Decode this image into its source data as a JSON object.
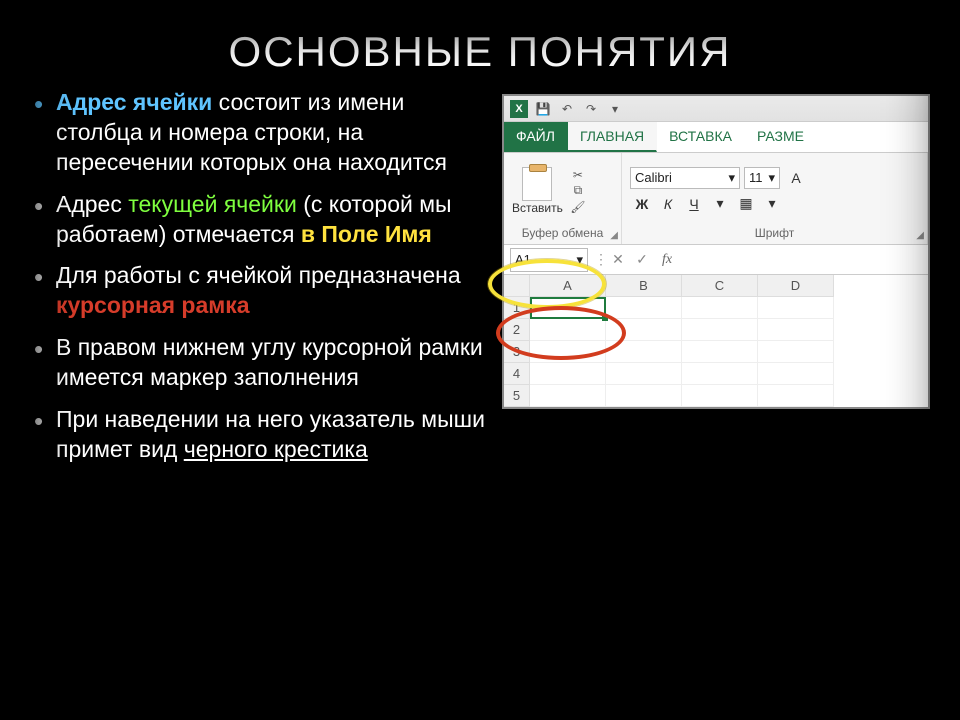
{
  "title": "ОСНОВНЫЕ ПОНЯТИЯ",
  "bullets": {
    "b1_blue": "Адрес ячейки",
    "b1_rest": " состоит из имени столбца и номера строки, на пересечении которых она находится",
    "b2a": "Адрес ",
    "b2_green": "текущей ячейки",
    "b2b": " (с которой мы работаем) отмечается ",
    "b2_yellow": "в Поле Имя",
    "b3a": "Для работы с ячейкой предназначена ",
    "b3_red": "курсорная рамка",
    "b4": "В правом нижнем углу курсорной рамки имеется маркер заполнения",
    "b5a": "При наведении на него указатель мыши примет вид ",
    "b5_u": "черного крестика"
  },
  "excel": {
    "qat_xl": "X",
    "tabs": {
      "file": "ФАЙЛ",
      "home": "ГЛАВНАЯ",
      "insert": "ВСТАВКА",
      "layout": "РАЗМЕ"
    },
    "paste_label": "Вставить",
    "group_clip": "Буфер обмена",
    "group_font": "Шрифт",
    "font_name": "Calibri",
    "font_size": "11",
    "fbtn_b": "Ж",
    "fbtn_i": "К",
    "fbtn_u": "Ч",
    "name_box": "A1",
    "fx": "fx",
    "cols": {
      "a": "A",
      "b": "B",
      "c": "C",
      "d": "D"
    },
    "rows": {
      "r1": "1",
      "r2": "2",
      "r3": "3",
      "r4": "4",
      "r5": "5"
    }
  }
}
